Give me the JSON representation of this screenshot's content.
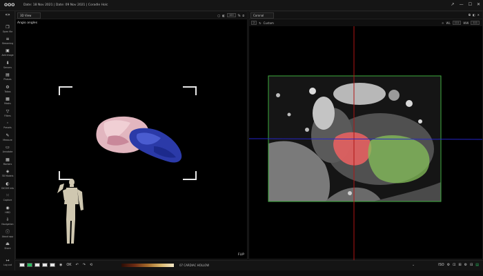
{
  "app": {
    "brand": "OOO",
    "title_info": "Date: 18 Nov 2021 | Date: 09 Nov 2021 | Coradle Holc"
  },
  "window_controls": [
    "↗",
    "—",
    "☐",
    "✕"
  ],
  "toolbar": {
    "items": [
      {
        "icon": "❐",
        "label": "Open file"
      },
      {
        "icon": "≡",
        "label": "Streaming"
      },
      {
        "icon": "▣",
        "label": "Add image"
      },
      {
        "icon": "⬇",
        "label": "Servers"
      },
      {
        "icon": "▤",
        "label": "Phases"
      },
      {
        "icon": "⚙",
        "label": "Tabas"
      },
      {
        "icon": "▦",
        "label": "Masks"
      },
      {
        "icon": "▽",
        "label": "Filters"
      },
      {
        "icon": "◦",
        "label": "Presets"
      },
      {
        "icon": "✎",
        "label": "Measure"
      },
      {
        "icon": "▭",
        "label": "Annotate"
      },
      {
        "icon": "▦",
        "label": "Markers"
      },
      {
        "icon": "◈",
        "label": "3D Models"
      },
      {
        "icon": "◐",
        "label": "DICOM info"
      },
      {
        "icon": "⁙",
        "label": "Capture"
      },
      {
        "icon": "◉",
        "label": "HMD"
      },
      {
        "icon": "⇩",
        "label": "Navigation"
      },
      {
        "icon": "ⓘ",
        "label": "About app"
      },
      {
        "icon": "⏏",
        "label": "Share"
      },
      {
        "icon": "↦",
        "label": "Log out"
      }
    ]
  },
  "left_view": {
    "selector": "3D View",
    "value_box": "100",
    "annotation": "Angio angles",
    "flip_label": "FLIP"
  },
  "right_view": {
    "selector": "Coronal",
    "sub_mode": "Custom",
    "sub_value": "2",
    "wl_label": "WL",
    "ww_label": "WW",
    "wl_value": "111",
    "ww_value": "111"
  },
  "bottom": {
    "ok_label": "OK",
    "lut_name": "07 CARDIAC HOLLOW",
    "right_icons": [
      "ISO",
      "⚙",
      "⊡",
      "⊞",
      "⚙",
      "⊟",
      "▤"
    ]
  },
  "colors": {
    "crosshair_vertical": "#b01515",
    "crosshair_horizontal": "#2525c8",
    "roi_box": "#3fae3f",
    "segment_red": "#e46060",
    "segment_green": "#86c05a",
    "model_blue": "#2a3aa8",
    "model_pink": "#e6b3bf"
  }
}
